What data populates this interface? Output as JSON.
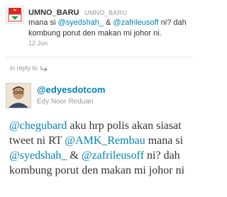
{
  "reply_tweet": {
    "username": "UMNO_BARU",
    "handle": "UMNO_BARU",
    "text_prefix": "mana si ",
    "mention_1": "@syedshah_",
    "text_mid": " & ",
    "mention_2": "@zafrileusoff",
    "text_suffix": " ni? dah kombung porut den makan mi johor ni.",
    "date": "12 Jun"
  },
  "in_reply_to_label": "in reply to",
  "main_tweet": {
    "handle": "@edyesdotcom",
    "display_name": "Edy Noor Reduan",
    "mention_1": "@chegubard",
    "text_1": " aku hrp polis akan siasat tweet ni RT ",
    "mention_2": "@AMK_Rembau",
    "text_2": " mana si ",
    "mention_3": "@syedshah_",
    "text_3": " & ",
    "mention_4": "@zafrileusoff",
    "text_4": " ni? dah kombung porut den makan mi johor ni"
  },
  "colors": {
    "link": "#0084b4",
    "muted": "#999999",
    "text": "#333333",
    "umno_red": "#d7282f",
    "umno_green": "#2e9a3d"
  }
}
